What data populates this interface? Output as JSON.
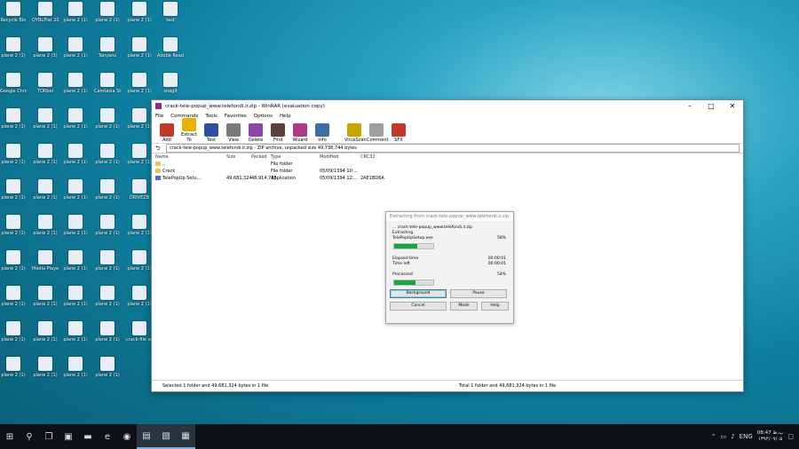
{
  "desktop": {
    "icons": [
      {
        "label": "Recycle Bin",
        "style": "g-doc"
      },
      {
        "label": "QYBLPlat 2017",
        "style": "g-blue"
      },
      {
        "label": "plane 2 (1)",
        "style": "g-doc"
      },
      {
        "label": "plane 2 (1)",
        "style": "g-doc"
      },
      {
        "label": "plane 2 (1)",
        "style": "g-doc"
      },
      {
        "label": "test",
        "style": "g-doc"
      },
      {
        "label": "plane 2 (1)",
        "style": "g-blue"
      },
      {
        "label": "plane 2 (3)",
        "style": "g-doc"
      },
      {
        "label": "plane 2 (1)",
        "style": "g-doc"
      },
      {
        "label": "Tanyano",
        "style": "g-green"
      },
      {
        "label": "plane 2 (1)",
        "style": "g-doc"
      },
      {
        "label": "Adobe Reader",
        "style": "g-red"
      },
      {
        "label": "Google Chrome",
        "style": "g-red"
      },
      {
        "label": "TORbel",
        "style": "g-doc"
      },
      {
        "label": "plane 2 (1)",
        "style": "g-green"
      },
      {
        "label": "Camtasia Studio 8",
        "style": "g-green"
      },
      {
        "label": "plane 2 (1)",
        "style": "g-doc"
      },
      {
        "label": "snagit",
        "style": "g-doc"
      },
      {
        "label": "plane 2 (1)",
        "style": "g-doc"
      },
      {
        "label": "plane 2 (1)",
        "style": "g-blue"
      },
      {
        "label": "plane 2 (1)",
        "style": "g-blue"
      },
      {
        "label": "plane 2 (1)",
        "style": "g-blue"
      },
      {
        "label": "plane 2 (1)",
        "style": "g-doc"
      },
      {
        "label": "TeamViewer Panel Online",
        "style": "g-blue"
      },
      {
        "label": "plane 2 (1)",
        "style": "g-blue"
      },
      {
        "label": "plane 2 (1)",
        "style": "g-doc"
      },
      {
        "label": "plane 2 (1)",
        "style": "g-doc"
      },
      {
        "label": "plane 2 (1)",
        "style": "g-purple"
      },
      {
        "label": "plane 2 (1)",
        "style": "g-blue"
      },
      {
        "label": "plane 2 (1)",
        "style": "g-blue"
      },
      {
        "label": "plane 2 (1)",
        "style": "g-doc"
      },
      {
        "label": "plane 2 (1)",
        "style": "g-doc"
      },
      {
        "label": "plane 2 (1)",
        "style": "g-doc"
      },
      {
        "label": "plane 2 (1)",
        "style": "g-blue"
      },
      {
        "label": "DRIVEZB",
        "style": "g-blue"
      },
      {
        "label": "plane 2 (1)",
        "style": "g-blue"
      },
      {
        "label": "plane 2 (1)",
        "style": "g-doc"
      },
      {
        "label": "plane 2 (1)",
        "style": "g-doc"
      },
      {
        "label": "plane 2 (1)",
        "style": "g-blue"
      },
      {
        "label": "plane 2 (1)",
        "style": "g-blue"
      },
      {
        "label": "plane 2 (1)",
        "style": "g-doc"
      },
      {
        "label": "plane 2 (1)",
        "style": "g-green"
      },
      {
        "label": "plane 2 (1)",
        "style": "g-doc"
      },
      {
        "label": "Media Player",
        "style": "g-red"
      },
      {
        "label": "plane 2 (1)",
        "style": "g-blue"
      },
      {
        "label": "plane 2 (1)",
        "style": "g-yellow"
      },
      {
        "label": "plane 2 (1)",
        "style": "g-doc"
      },
      {
        "label": "plane 2 (1)",
        "style": "g-doc"
      },
      {
        "label": "plane 2 (1)",
        "style": "g-green"
      },
      {
        "label": "plane 2 (1)",
        "style": "g-yellow"
      },
      {
        "label": "plane 2 (1)",
        "style": "g-doc"
      },
      {
        "label": "plane 2 (1)",
        "style": "g-doc"
      },
      {
        "label": "plane 2 (1)",
        "style": "g-blue"
      },
      {
        "label": "plane 2 (1)",
        "style": "g-purple"
      },
      {
        "label": "plane 2 (1)",
        "style": "g-blue"
      },
      {
        "label": "plane 2 (1)",
        "style": "g-doc"
      },
      {
        "label": "plane 2 (1)",
        "style": "g-purple"
      },
      {
        "label": "plane 2 (1)",
        "style": "g-doc"
      },
      {
        "label": "crack-file setup",
        "style": "g-doc"
      },
      {
        "label": "plane 2 (1)",
        "style": "g-blue"
      },
      {
        "label": "plane 2 (1)",
        "style": "g-yellow"
      },
      {
        "label": "plane 2 (1)",
        "style": "g-doc"
      },
      {
        "label": "plane 2 (1)",
        "style": "g-doc"
      },
      {
        "label": "plane 2 (1)",
        "style": "g-doc"
      }
    ]
  },
  "window": {
    "title": "crack-tele-popup_www.telefondi.ir.zip - WinRAR (evaluation copy)",
    "menu": [
      "File",
      "Commands",
      "Tools",
      "Favorites",
      "Options",
      "Help"
    ],
    "toolbar": [
      {
        "label": "Add",
        "color": "#c0392b"
      },
      {
        "label": "Extract To",
        "color": "#e6b400"
      },
      {
        "label": "Test",
        "color": "#2d4fa3"
      },
      {
        "label": "View",
        "color": "#7a7a7a"
      },
      {
        "label": "Delete",
        "color": "#8e44ad"
      },
      {
        "label": "Find",
        "color": "#5d4037"
      },
      {
        "label": "Wizard",
        "color": "#b03a8a"
      },
      {
        "label": "Info",
        "color": "#3a6ea5"
      },
      {
        "label": "VirusScan",
        "color": "#c9a400"
      },
      {
        "label": "Comment",
        "color": "#9e9e9e"
      },
      {
        "label": "SFX",
        "color": "#c0392b"
      }
    ],
    "address": "crack-tele-popup_www.telefondi.ir.zip - ZIP archive, unpacked size 49,738,744 bytes",
    "columns": [
      "Name",
      "Size",
      "Packed",
      "Type",
      "Modified",
      "CRC32"
    ],
    "rows": [
      {
        "name": "..",
        "size": "",
        "packed": "",
        "type": "File folder",
        "modified": "",
        "crc": ""
      },
      {
        "name": "Crack",
        "size": "",
        "packed": "",
        "type": "File folder",
        "modified": "05/09/1394 10:...",
        "crc": ""
      },
      {
        "name": "TelePopUp Setu...",
        "size": "49,681,324",
        "packed": "48,914,735",
        "type": "Application",
        "modified": "05/09/1394 12:...",
        "crc": "2AE1BD6A"
      }
    ],
    "status_left": "Selected 1 folder and 49,681,324 bytes in 1 file",
    "status_right": "Total 1 folder and 49,681,324 bytes in 1 file"
  },
  "dialog": {
    "title": "Extracting from crack-tele-popup_www.telefondi.ir.zip",
    "line1": "... crack-tele-popup_www.telefondi.ir.zip",
    "line2": "Extracting",
    "line3": "TelePopUpSetup.exe",
    "file_percent": "58%",
    "file_progress": 0.58,
    "elapsed_label": "Elapsed time",
    "elapsed_value": "00:00:01",
    "remaining_label": "Time left",
    "remaining_value": "00:00:01",
    "processed_label": "Processed",
    "processed_percent": "54%",
    "processed_progress": 0.54,
    "btn_background": "Background",
    "btn_pause": "Pause",
    "btn_cancel": "Cancel",
    "btn_mode": "Mode",
    "btn_help": "Help"
  },
  "taskbar": {
    "items": [
      "start-icon",
      "search-icon",
      "task-view-icon",
      "store-icon",
      "file-explorer-icon",
      "edge-icon",
      "chrome-icon",
      "camtasia-icon",
      "notepad-icon",
      "winrar-icon"
    ],
    "tray_lang": "ENG",
    "clock_time": "08:47 ب.ظ",
    "clock_date": "۱۳۹۴/۰۹/۰۵"
  }
}
